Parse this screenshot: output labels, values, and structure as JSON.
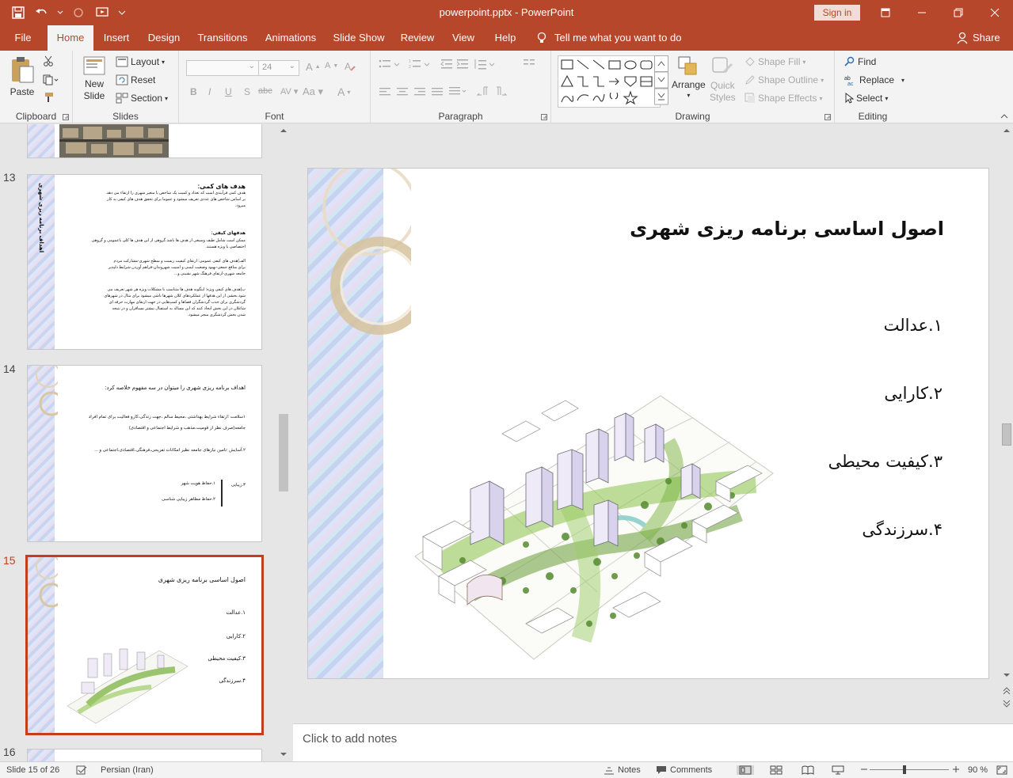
{
  "window": {
    "doc_title": "powerpoint.pptx  -  PowerPoint",
    "signin": "Sign in"
  },
  "tabs": [
    "File",
    "Home",
    "Insert",
    "Design",
    "Transitions",
    "Animations",
    "Slide Show",
    "Review",
    "View",
    "Help"
  ],
  "tellme": "Tell me what you want to do",
  "share": "Share",
  "ribbon": {
    "clipboard": {
      "label": "Clipboard",
      "paste": "Paste"
    },
    "slides": {
      "label": "Slides",
      "new_slide_1": "New",
      "new_slide_2": "Slide",
      "layout": "Layout",
      "reset": "Reset",
      "section": "Section"
    },
    "font": {
      "label": "Font",
      "size": "24"
    },
    "paragraph": {
      "label": "Paragraph"
    },
    "drawing": {
      "label": "Drawing",
      "arrange": "Arrange",
      "quick_1": "Quick",
      "quick_2": "Styles",
      "fill": "Shape Fill",
      "outline": "Shape Outline",
      "effects": "Shape Effects"
    },
    "editing": {
      "label": "Editing",
      "find": "Find",
      "replace": "Replace",
      "select": "Select"
    }
  },
  "thumbnails": {
    "slide13": {
      "num": "13",
      "side": "اهداف برنامه ریزی شهری",
      "lines": [
        "هدف های کمی:",
        "هدف کمی فرآیندی است که تعداد و کمیت یک شاخص یا متغیر شهری را ارتقاء می دهد.",
        "بر اساس شاخص های عددی تعریف میشود و عموما برای تحقق هدف های کیفی به کار",
        "میرود.",
        "هدفهای کیفی:",
        "ممکن است شامل طیف وسیعی از هدف ها باشد.گروهی از این هدف ها کلی یاعمومی و گروهی",
        "اختصاصی یا ویژه هستند.",
        "الف)هدف های کیفی عمومی: ارتقای کیفیت زیست و سطح شهری-مشارکت مردم",
        "برای منافع جمعی-بهبود وضعیت ایمنی و امنیت شهروندان-فراهم آوردن شرایط دلپذیر",
        "جامعه شهری-ارتقای فرهنگ شهر نشینی و...",
        "ب)هدف های کیفی ویژه: اینگونه هدف ها متناسب با مشکلات ویژه هر شهر تعریف می",
        "شود.بخشی از این هدفها از عملکردهای کلان شهرها ناشی میشود برای مثال در شهرهای",
        "گردشگری برای جذب گردشگران فضاها و کمپ‌هایی در جهت ارتقای مهارت حرفه ای",
        "شاغلان در این بخش ایجاد کنند که این مساله به استقبال بیشتر مسافران و در نتیجه",
        "شدن بخش گردشگری منجر میشود."
      ]
    },
    "slide14": {
      "num": "14",
      "lines": [
        "اهداف برنامه ریزی شهری را میتوان در سه مفهوم خلاصه کرد:",
        "۱سلامت :ارتقاء شرایط بهداشتی ،محیط سالم ،جهت زندگی،کارو فعالیت برای تمام افراد",
        "جامعه(صرف نظر از قومیت،مذهب و شرایط اجتماعی و اقتصادی)",
        "۲.آسایش :تامین نیازهای جامعه نظیر امکانات تفریحی،فرهنگی،اقتصادی،اجتماعی و ...",
        "۳.زیبایی",
        "۱.حفاظ هویت شهر",
        "۲.حفاظ مظاهر زیبایی شناسی"
      ]
    },
    "slide15": {
      "num": "15",
      "title": "اصول اساسی برنامه ریزی شهری",
      "items": [
        "۱.عدالت",
        "۲.کارایی",
        "۳.کیفیت محیطی",
        "۴.سرزندگی"
      ]
    },
    "slide16": {
      "num": "16"
    }
  },
  "slide": {
    "title": "اصول اساسی برنامه ریزی شهری",
    "items": [
      "۱.عدالت",
      "۲.کارایی",
      "۳.کیفیت محیطی",
      "۴.سرزندگی"
    ]
  },
  "notes_placeholder": "Click to add notes",
  "status": {
    "slide_info": "Slide 15 of 26",
    "language": "Persian (Iran)",
    "notes": "Notes",
    "comments": "Comments",
    "zoom": "90 %"
  },
  "colors": {
    "accent": "#b7472a",
    "selected": "#c43e1c"
  }
}
